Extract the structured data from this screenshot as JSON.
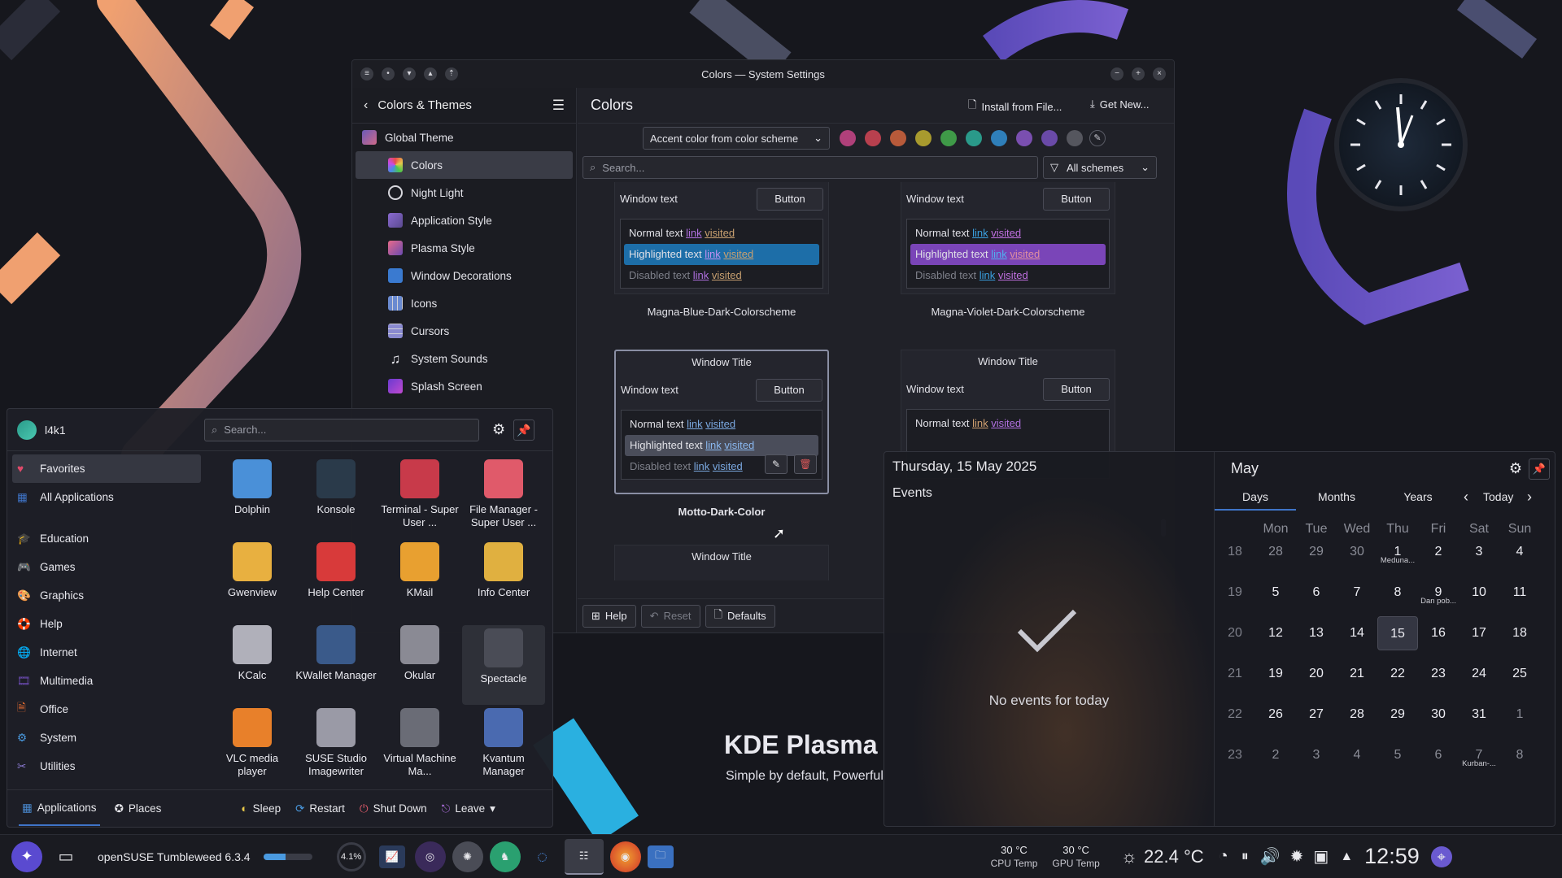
{
  "window": {
    "title": "Colors — System Settings"
  },
  "sidebar": {
    "back_label": "Colors & Themes",
    "items": [
      {
        "label": "Global Theme"
      },
      {
        "label": "Colors"
      },
      {
        "label": "Night Light"
      },
      {
        "label": "Application Style"
      },
      {
        "label": "Plasma Style"
      },
      {
        "label": "Window Decorations"
      },
      {
        "label": "Icons"
      },
      {
        "label": "Cursors"
      },
      {
        "label": "System Sounds"
      },
      {
        "label": "Splash Screen"
      }
    ]
  },
  "content": {
    "title": "Colors",
    "install_label": "Install from File...",
    "get_new_label": "Get New...",
    "accent_dropdown": "Accent color from color scheme",
    "accent_swatches": [
      "#b0407a",
      "#b8404e",
      "#b85a3a",
      "#a89a2e",
      "#3f9a48",
      "#2a9a8a",
      "#2f7fba",
      "#7a4fb0",
      "#6a4aa8",
      "#55565e"
    ],
    "search_placeholder": "Search...",
    "filter_label": "All schemes",
    "preview_labels": {
      "window_title": "Window Title",
      "window_text": "Window text",
      "button": "Button",
      "normal_text": "Normal text",
      "highlighted_text": "Highlighted text",
      "disabled_text": "Disabled text",
      "link": "link",
      "visited": "visited"
    },
    "schemes": [
      {
        "name": "Magna-Blue-Dark-Colorscheme",
        "highlight": "#1d6ea8"
      },
      {
        "name": "Magna-Violet-Dark-Colorscheme",
        "highlight": "#7a45b8"
      },
      {
        "name": "Motto-Dark-Color",
        "highlight": "#4a4d5a"
      },
      {
        "name": "",
        "highlight": "#3a3c46"
      }
    ],
    "footer": {
      "help": "Help",
      "reset": "Reset",
      "defaults": "Defaults"
    }
  },
  "launcher": {
    "user": "l4k1",
    "search_placeholder": "Search...",
    "categories": [
      "Favorites",
      "All Applications",
      "Education",
      "Games",
      "Graphics",
      "Help",
      "Internet",
      "Multimedia",
      "Office",
      "System",
      "Utilities"
    ],
    "apps": [
      {
        "name": "Dolphin"
      },
      {
        "name": "Konsole"
      },
      {
        "name": "Terminal - Super User ..."
      },
      {
        "name": "File Manager - Super User ..."
      },
      {
        "name": "Gwenview"
      },
      {
        "name": "Help Center"
      },
      {
        "name": "KMail"
      },
      {
        "name": "Info Center"
      },
      {
        "name": "KCalc"
      },
      {
        "name": "KWallet Manager"
      },
      {
        "name": "Okular"
      },
      {
        "name": "Spectacle"
      },
      {
        "name": "VLC media player"
      },
      {
        "name": "SUSE Studio Imagewriter"
      },
      {
        "name": "Virtual Machine Ma..."
      },
      {
        "name": "Kvantum Manager"
      }
    ],
    "footer": {
      "applications": "Applications",
      "places": "Places",
      "sleep": "Sleep",
      "restart": "Restart",
      "shutdown": "Shut Down",
      "leave": "Leave"
    }
  },
  "calendar": {
    "date_heading": "Thursday, 15 May 2025",
    "events_label": "Events",
    "no_events": "No events for today",
    "month": "May",
    "tabs": [
      "Days",
      "Months",
      "Years"
    ],
    "today_label": "Today",
    "weekdays": [
      "Mon",
      "Tue",
      "Wed",
      "Thu",
      "Fri",
      "Sat",
      "Sun"
    ],
    "weeks": [
      {
        "wk": "18",
        "days": [
          {
            "d": "28",
            "o": true
          },
          {
            "d": "29",
            "o": true
          },
          {
            "d": "30",
            "o": true
          },
          {
            "d": "1",
            "s": "Meduna..."
          },
          {
            "d": "2"
          },
          {
            "d": "3"
          },
          {
            "d": "4"
          }
        ]
      },
      {
        "wk": "19",
        "days": [
          {
            "d": "5"
          },
          {
            "d": "6"
          },
          {
            "d": "7"
          },
          {
            "d": "8"
          },
          {
            "d": "9",
            "s": "Dan pob..."
          },
          {
            "d": "10"
          },
          {
            "d": "11"
          }
        ]
      },
      {
        "wk": "20",
        "days": [
          {
            "d": "12"
          },
          {
            "d": "13"
          },
          {
            "d": "14"
          },
          {
            "d": "15",
            "t": true
          },
          {
            "d": "16"
          },
          {
            "d": "17"
          },
          {
            "d": "18"
          }
        ]
      },
      {
        "wk": "21",
        "days": [
          {
            "d": "19"
          },
          {
            "d": "20"
          },
          {
            "d": "21"
          },
          {
            "d": "22"
          },
          {
            "d": "23"
          },
          {
            "d": "24"
          },
          {
            "d": "25"
          }
        ]
      },
      {
        "wk": "22",
        "days": [
          {
            "d": "26"
          },
          {
            "d": "27"
          },
          {
            "d": "28"
          },
          {
            "d": "29"
          },
          {
            "d": "30"
          },
          {
            "d": "31"
          },
          {
            "d": "1",
            "o": true
          }
        ]
      },
      {
        "wk": "23",
        "days": [
          {
            "d": "2",
            "o": true
          },
          {
            "d": "3",
            "o": true
          },
          {
            "d": "4",
            "o": true
          },
          {
            "d": "5",
            "o": true
          },
          {
            "d": "6",
            "o": true
          },
          {
            "d": "7",
            "o": true,
            "s": "Kurban-..."
          },
          {
            "d": "8",
            "o": true
          }
        ]
      }
    ]
  },
  "desktop": {
    "kde_logo": "KDE Plasma",
    "kde_tagline": "Simple by default, Powerful"
  },
  "taskbar": {
    "os_label": "openSUSE Tumbleweed 6.3.4",
    "cpu_load": "4.1%",
    "cpu_temp_value": "30 °C",
    "cpu_temp_label": "CPU Temp",
    "gpu_temp_value": "30 °C",
    "gpu_temp_label": "GPU Temp",
    "weather": "22.4 °C",
    "clock": "12:59",
    "progress": 0.45
  },
  "colors": {
    "accent": "#3f74c8",
    "background": "#16171d"
  }
}
